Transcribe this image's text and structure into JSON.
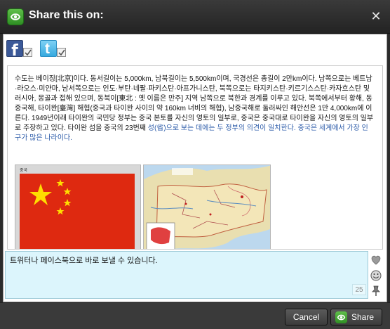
{
  "dialog": {
    "title": "Share this on:",
    "close_symbol": "✕"
  },
  "networks": [
    {
      "name": "Facebook",
      "icon": "facebook-icon",
      "glyph": "f",
      "color": "#3b5998",
      "checked": true
    },
    {
      "name": "Twitter",
      "icon": "twitter-icon",
      "glyph": "t",
      "color": "#36a9df",
      "checked": true
    }
  ],
  "preview": {
    "article_text": "수도는 베이징[北京]이다. 동서길이는 5,000km, 남북길이는 5,500km이며, 국경선은 총길이 2만km이다. 남쪽으로는 베트남·라오스·미얀마, 남서쪽으로는 인도·부탄·네팔·파키스탄·아프가니스탄, 북쪽으로는 타지키스탄·키르기스스탄·카자흐스탄 및 러시아, 몽골과 접해 있으며, 동북이[東北 : 옛 이름은 만주] 지역 남쪽으로 북한과 경계를 이루고 있다. 북쪽에서부터 황해, 동중국해, 타이완[臺灣] 해협(중국과 타이완 사이의 약 160km 너비의 해협), 남중국해로 둘러싸인 해안선은 1만 4,000km에 이른다. 1949년이래 타이완의 국민당 정부는 중국 본토를 자신의 영토의 일부로, 중국은 중국대로 타이완을 자신의 영토의 일부로 주장하고 있다. 타이완 섬을 중국의 23번째",
    "article_link": "성(省)으로 보는 데에는 두 정부의 의견이 일치한다. 중국은 세계에서 가장 인구가 많은 나라이다.",
    "flag_caption": "중국",
    "flag_color": "#de2910",
    "star_color": "#ffde00"
  },
  "compose": {
    "message": "트위터나 페이스북으로 바로 보낼 수 있습니다.",
    "char_count": "25",
    "accent": "#dcf5fc"
  },
  "side_icons": [
    "heart-icon",
    "smiley-icon",
    "pin-icon"
  ],
  "footer": {
    "cancel_label": "Cancel",
    "share_label": "Share"
  }
}
